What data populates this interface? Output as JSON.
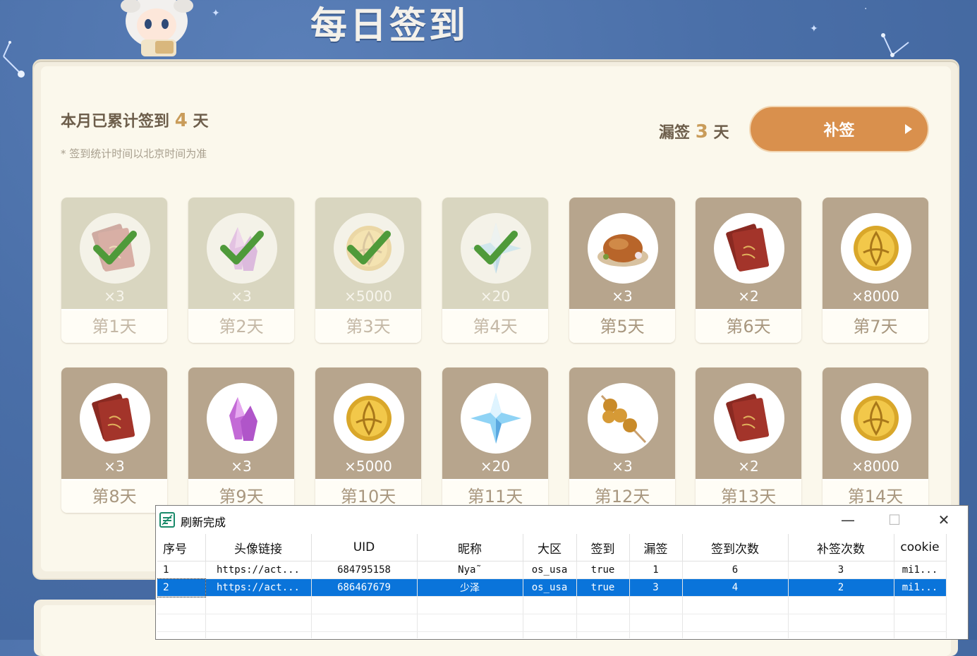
{
  "page_title": "每日签到",
  "summary": {
    "prefix": "本月已累计签到",
    "count": "4",
    "suffix": "天",
    "note": "* 签到统计时间以北京时间为准"
  },
  "missed": {
    "prefix": "漏签",
    "count": "3",
    "suffix": "天"
  },
  "makeup_button": "补签",
  "days": [
    {
      "label": "第1天",
      "qty": "×3",
      "item": "wit-book-icon",
      "done": true
    },
    {
      "label": "第2天",
      "qty": "×3",
      "item": "crystal-icon",
      "done": true
    },
    {
      "label": "第3天",
      "qty": "×5000",
      "item": "mora-icon",
      "done": true
    },
    {
      "label": "第4天",
      "qty": "×20",
      "item": "primogem-icon",
      "done": true
    },
    {
      "label": "第5天",
      "qty": "×3",
      "item": "roast-chicken-icon",
      "done": false
    },
    {
      "label": "第6天",
      "qty": "×2",
      "item": "wit-book-icon",
      "done": false
    },
    {
      "label": "第7天",
      "qty": "×8000",
      "item": "mora-icon",
      "done": false
    },
    {
      "label": "第8天",
      "qty": "×3",
      "item": "wit-book-icon",
      "done": false
    },
    {
      "label": "第9天",
      "qty": "×3",
      "item": "crystal-icon",
      "done": false
    },
    {
      "label": "第10天",
      "qty": "×5000",
      "item": "mora-icon",
      "done": false
    },
    {
      "label": "第11天",
      "qty": "×20",
      "item": "primogem-icon",
      "done": false
    },
    {
      "label": "第12天",
      "qty": "×3",
      "item": "skewer-icon",
      "done": false
    },
    {
      "label": "第13天",
      "qty": "×2",
      "item": "wit-book-icon",
      "done": false
    },
    {
      "label": "第14天",
      "qty": "×8000",
      "item": "mora-icon",
      "done": false
    }
  ],
  "dialog": {
    "title": "刷新完成",
    "minimize": "—",
    "maximize": "☐",
    "close": "✕",
    "columns": [
      "序号",
      "头像链接",
      "UID",
      "昵称",
      "大区",
      "签到",
      "漏签",
      "签到次数",
      "补签次数",
      "cookie"
    ],
    "rows": [
      [
        "1",
        "https://act...",
        "684795158",
        "Nya˜",
        "os_usa",
        "true",
        "1",
        "6",
        "3",
        "mi1..."
      ],
      [
        "2",
        "https://act...",
        "686467679",
        "少泽",
        "os_usa",
        "true",
        "3",
        "4",
        "2",
        "mi1..."
      ]
    ],
    "selected_row": 1
  },
  "colors": {
    "background": "#4a6fa8",
    "accent": "#d9904d",
    "highlight_number": "#c99c5a",
    "selection": "#0a74da"
  }
}
